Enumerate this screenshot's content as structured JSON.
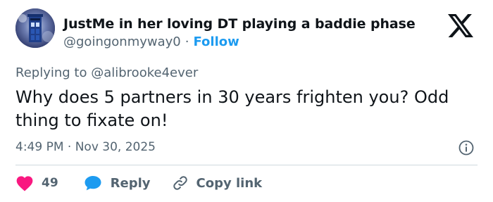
{
  "tweet": {
    "display_name": "JustMe in her loving DT playing a baddie phase",
    "handle": "@goingonmyway0",
    "separator": "·",
    "follow_label": "Follow",
    "replying_prefix": "Replying to",
    "replying_to": "@alibrooke4ever",
    "text": "Why does 5 partners in 30 years frighten you? Odd thing to fixate on!",
    "timestamp": "4:49 PM · Nov 30, 2025"
  },
  "actions": {
    "like_count": "49",
    "reply_label": "Reply",
    "copy_link_label": "Copy link"
  },
  "colors": {
    "accent": "#1d9bf0",
    "like": "#f91880",
    "secondary_text": "#536471",
    "divider": "#cfd9de"
  },
  "icons": {
    "brand": "x-logo-icon",
    "info": "info-icon",
    "like": "heart-icon",
    "reply": "speech-bubble-icon",
    "copy": "link-icon"
  }
}
